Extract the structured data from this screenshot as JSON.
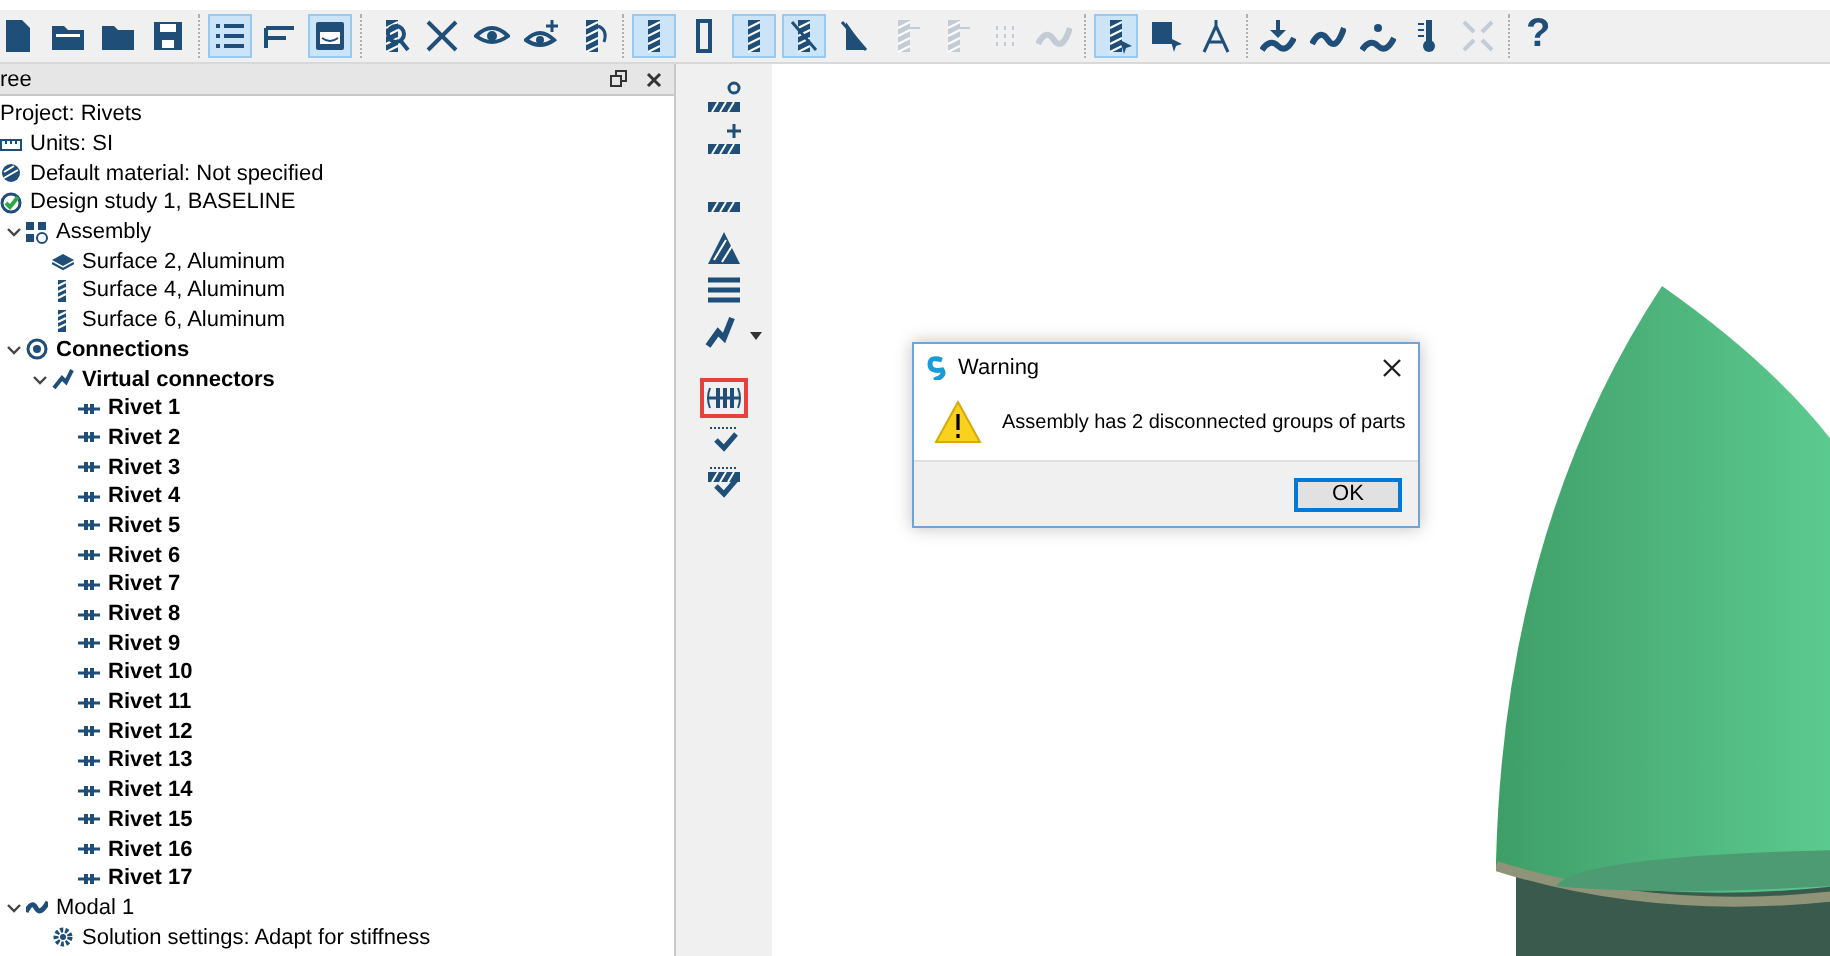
{
  "toolbar": {
    "groups": [
      [
        {
          "kind": "doc",
          "selected": false,
          "disabled": false
        },
        {
          "kind": "folder-open",
          "selected": false,
          "disabled": false
        },
        {
          "kind": "folder",
          "selected": false,
          "disabled": false
        },
        {
          "kind": "save",
          "selected": false,
          "disabled": false
        }
      ],
      [
        {
          "kind": "list",
          "selected": true,
          "disabled": false
        },
        {
          "kind": "bars",
          "selected": false,
          "disabled": false
        },
        {
          "kind": "tray",
          "selected": true,
          "disabled": false
        }
      ],
      [
        {
          "kind": "magnify",
          "selected": false,
          "disabled": false
        },
        {
          "kind": "cross",
          "selected": false,
          "disabled": false
        },
        {
          "kind": "eye",
          "selected": false,
          "disabled": false
        },
        {
          "kind": "eye-plus",
          "selected": false,
          "disabled": false
        },
        {
          "kind": "box-arrow",
          "selected": false,
          "disabled": false
        }
      ],
      [
        {
          "kind": "spring",
          "selected": true,
          "disabled": false
        },
        {
          "kind": "frame",
          "selected": false,
          "disabled": false
        },
        {
          "kind": "spring",
          "selected": true,
          "disabled": false
        },
        {
          "kind": "spring-slash",
          "selected": true,
          "disabled": false
        },
        {
          "kind": "slash-box",
          "selected": false,
          "disabled": false
        },
        {
          "kind": "spring-pin",
          "selected": false,
          "disabled": true
        },
        {
          "kind": "spring-pin",
          "selected": false,
          "disabled": true
        },
        {
          "kind": "grid",
          "selected": false,
          "disabled": true
        },
        {
          "kind": "wave",
          "selected": false,
          "disabled": true
        }
      ],
      [
        {
          "kind": "spring-cursor",
          "selected": true,
          "disabled": false
        },
        {
          "kind": "box-cursor",
          "selected": false,
          "disabled": false
        },
        {
          "kind": "compass",
          "selected": false,
          "disabled": false
        }
      ],
      [
        {
          "kind": "arrow-down",
          "selected": false,
          "disabled": false
        },
        {
          "kind": "wave",
          "selected": false,
          "disabled": false
        },
        {
          "kind": "arrows-out",
          "selected": false,
          "disabled": false
        },
        {
          "kind": "thermometer",
          "selected": false,
          "disabled": false
        },
        {
          "kind": "shrink",
          "selected": false,
          "disabled": true
        }
      ]
    ],
    "help_button": {
      "label": "?"
    }
  },
  "panel": {
    "title": "ree",
    "tree": [
      {
        "label": "Project: Rivets",
        "kind": "none",
        "bold": false
      },
      {
        "label": "Units: SI",
        "kind": "ruler",
        "bold": false
      },
      {
        "label": "Default material: Not specified",
        "kind": "material",
        "bold": false
      },
      {
        "label": "Design study 1, BASELINE",
        "kind": "study",
        "bold": false
      },
      {
        "label": "Assembly",
        "kind": "assembly",
        "bold": false,
        "expanded": true,
        "children": [
          {
            "label": "Surface 2, Aluminum",
            "kind": "plate",
            "bold": false
          },
          {
            "label": "Surface 4, Aluminum",
            "kind": "spring",
            "bold": false
          },
          {
            "label": "Surface 6, Aluminum",
            "kind": "spring",
            "bold": false
          }
        ]
      },
      {
        "label": "Connections",
        "kind": "connections",
        "bold": true,
        "expanded": true,
        "children": [
          {
            "label": "Virtual connectors",
            "kind": "connector",
            "bold": true,
            "expanded": true,
            "children": [
              {
                "label": "Rivet 1",
                "kind": "rivet",
                "bold": true
              },
              {
                "label": "Rivet 2",
                "kind": "rivet",
                "bold": true
              },
              {
                "label": "Rivet 3",
                "kind": "rivet",
                "bold": true
              },
              {
                "label": "Rivet 4",
                "kind": "rivet",
                "bold": true
              },
              {
                "label": "Rivet 5",
                "kind": "rivet",
                "bold": true
              },
              {
                "label": "Rivet 6",
                "kind": "rivet",
                "bold": true
              },
              {
                "label": "Rivet 7",
                "kind": "rivet",
                "bold": true
              },
              {
                "label": "Rivet 8",
                "kind": "rivet",
                "bold": true
              },
              {
                "label": "Rivet 9",
                "kind": "rivet",
                "bold": true
              },
              {
                "label": "Rivet 10",
                "kind": "rivet",
                "bold": true
              },
              {
                "label": "Rivet 11",
                "kind": "rivet",
                "bold": true
              },
              {
                "label": "Rivet 12",
                "kind": "rivet",
                "bold": true
              },
              {
                "label": "Rivet 13",
                "kind": "rivet",
                "bold": true
              },
              {
                "label": "Rivet 14",
                "kind": "rivet",
                "bold": true
              },
              {
                "label": "Rivet 15",
                "kind": "rivet",
                "bold": true
              },
              {
                "label": "Rivet 16",
                "kind": "rivet",
                "bold": true
              },
              {
                "label": "Rivet 17",
                "kind": "rivet",
                "bold": true
              }
            ]
          }
        ]
      },
      {
        "label": "Modal 1",
        "kind": "modal",
        "bold": false,
        "expanded": true,
        "children": [
          {
            "label": "Solution settings: Adapt for stiffness",
            "kind": "gear",
            "bold": false
          }
        ]
      }
    ]
  },
  "side_toolbar": [
    [
      {
        "kind": "abc-c",
        "highlighted": false
      },
      {
        "kind": "abc-plus",
        "highlighted": false
      }
    ],
    [
      {
        "kind": "bar",
        "highlighted": false
      },
      {
        "kind": "stack",
        "highlighted": false
      },
      {
        "kind": "lines",
        "highlighted": false
      },
      {
        "kind": "connector-menu",
        "highlighted": false
      }
    ],
    [
      {
        "kind": "rivet",
        "highlighted": true
      },
      {
        "kind": "check-dots",
        "highlighted": false
      },
      {
        "kind": "check-stack",
        "highlighted": false
      }
    ]
  ],
  "dialog": {
    "title": "Warning",
    "message": "Assembly has 2 disconnected groups of parts",
    "buttons": [
      {
        "label": "OK",
        "selected": true
      }
    ]
  }
}
